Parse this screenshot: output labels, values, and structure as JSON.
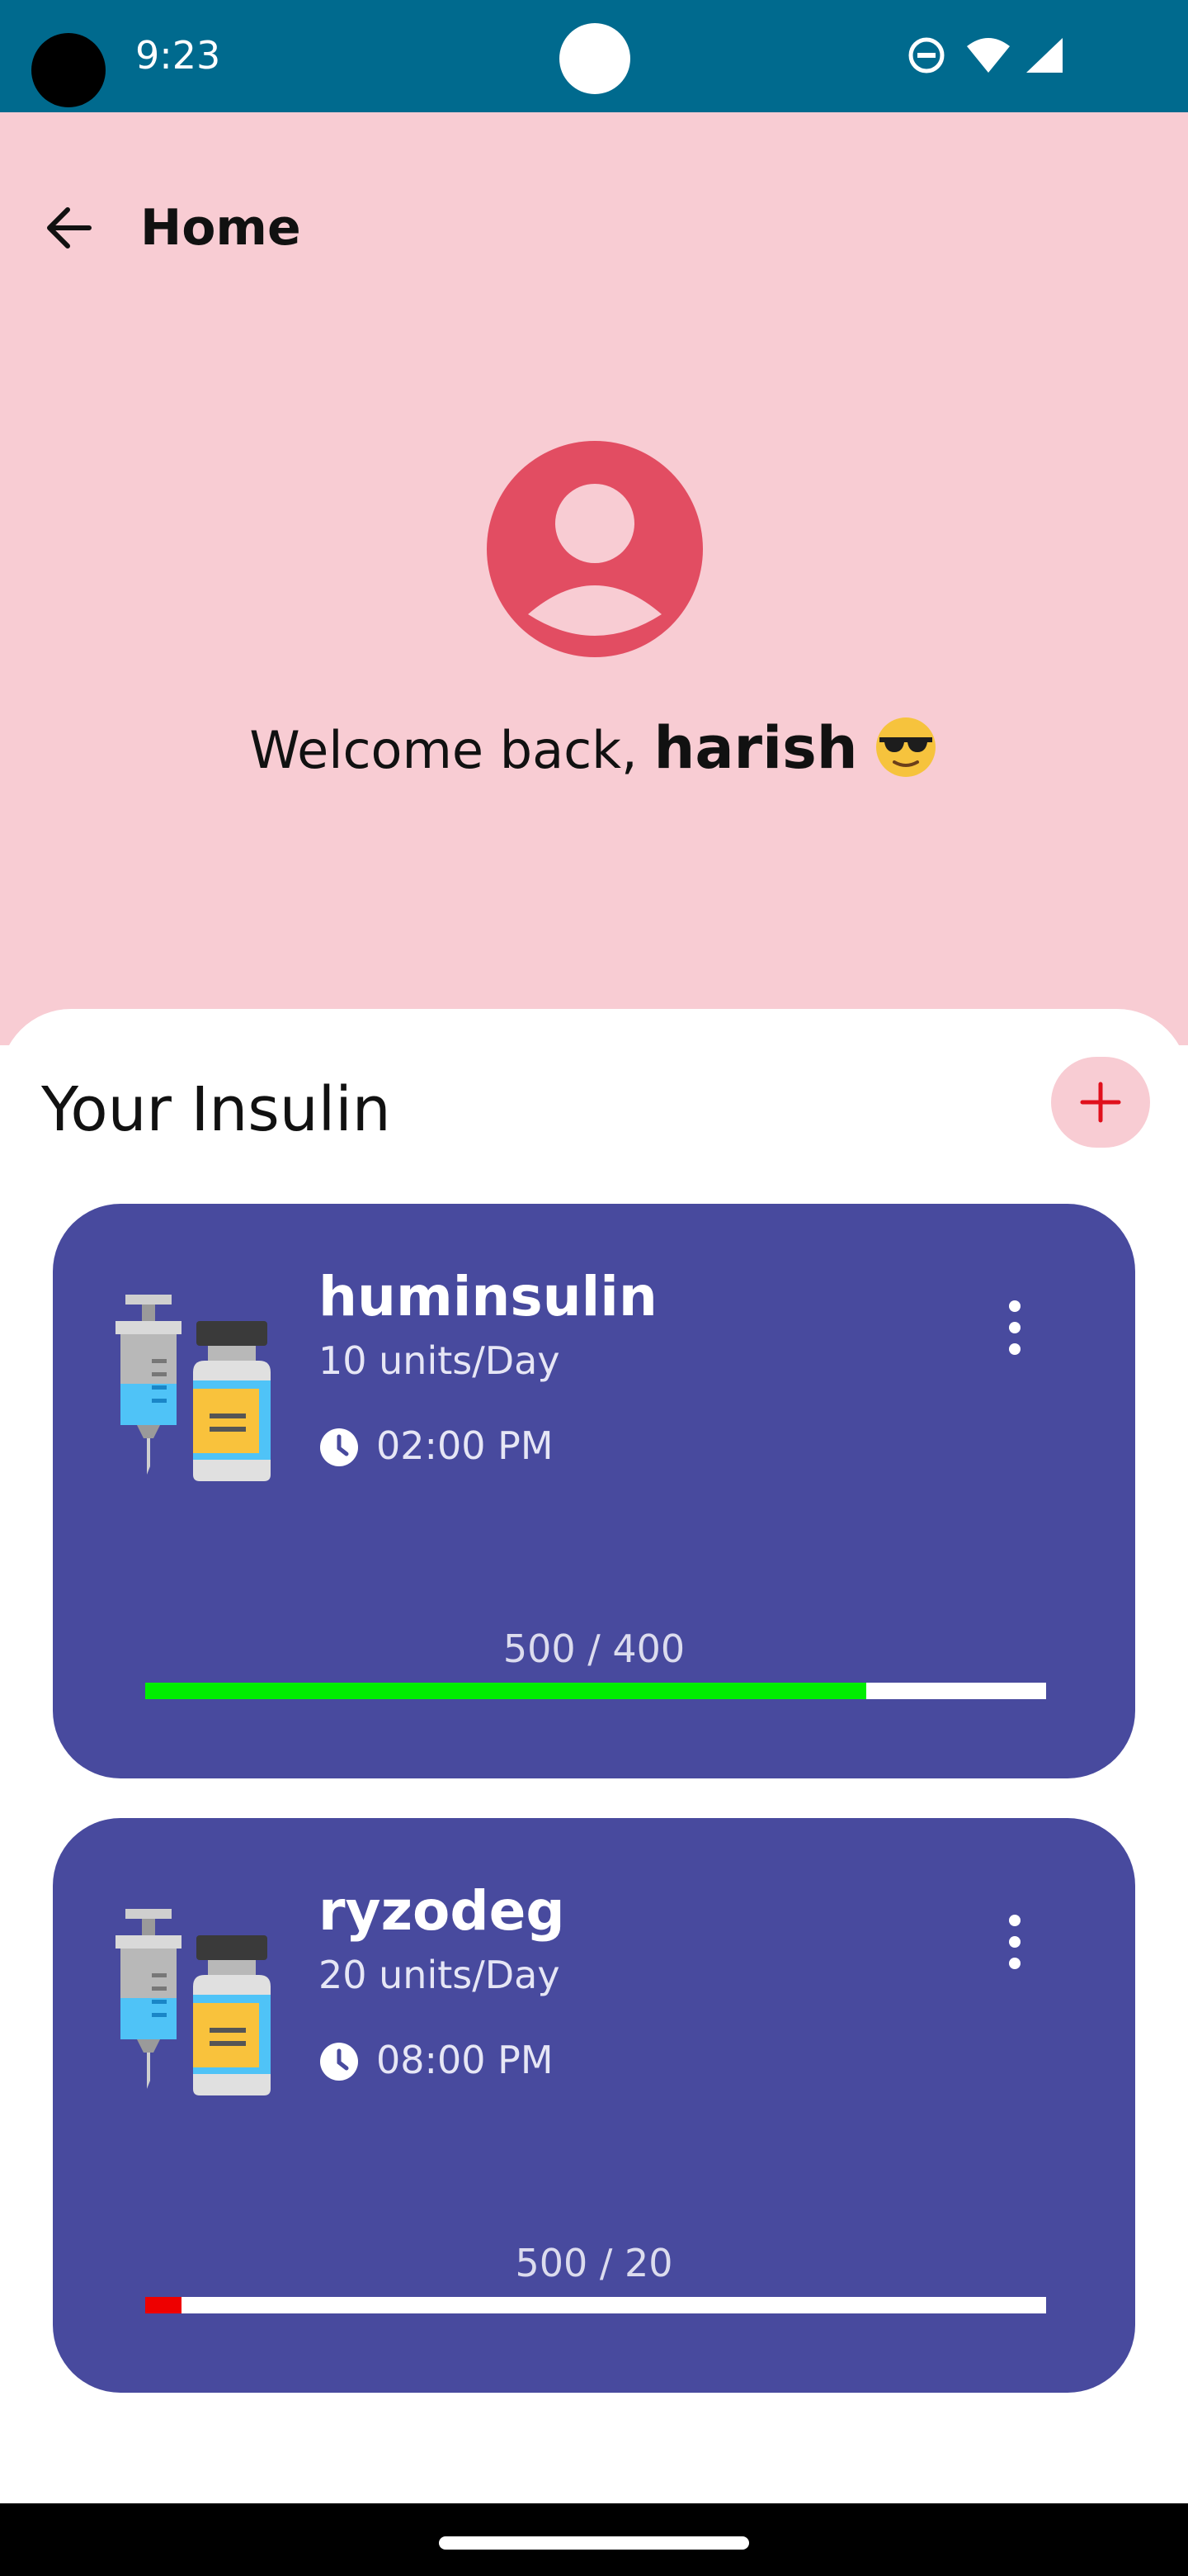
{
  "status_bar": {
    "time": "9:23"
  },
  "app_bar": {
    "title": "Home"
  },
  "welcome": {
    "prefix": "Welcome back, ",
    "username": "harish",
    "emoji": "smiling-face-with-sunglasses"
  },
  "section": {
    "title": "Your Insulin",
    "add_icon": "plus-icon"
  },
  "insulins": [
    {
      "name": "huminsulin",
      "dose": "10 units/Day",
      "time": "02:00 PM",
      "count": "500 / 400",
      "progress": 0.8,
      "bar_color": "#00ee00"
    },
    {
      "name": "ryzodeg",
      "dose": "20 units/Day",
      "time": "08:00 PM",
      "count": "500 / 20",
      "progress": 0.04,
      "bar_color": "#ee0000"
    }
  ],
  "colors": {
    "status_bar": "#006a8e",
    "header_bg": "#f8ccd3",
    "avatar": "#e24d62",
    "card_bg": "#484a9e",
    "add_plus": "#e0101c"
  }
}
